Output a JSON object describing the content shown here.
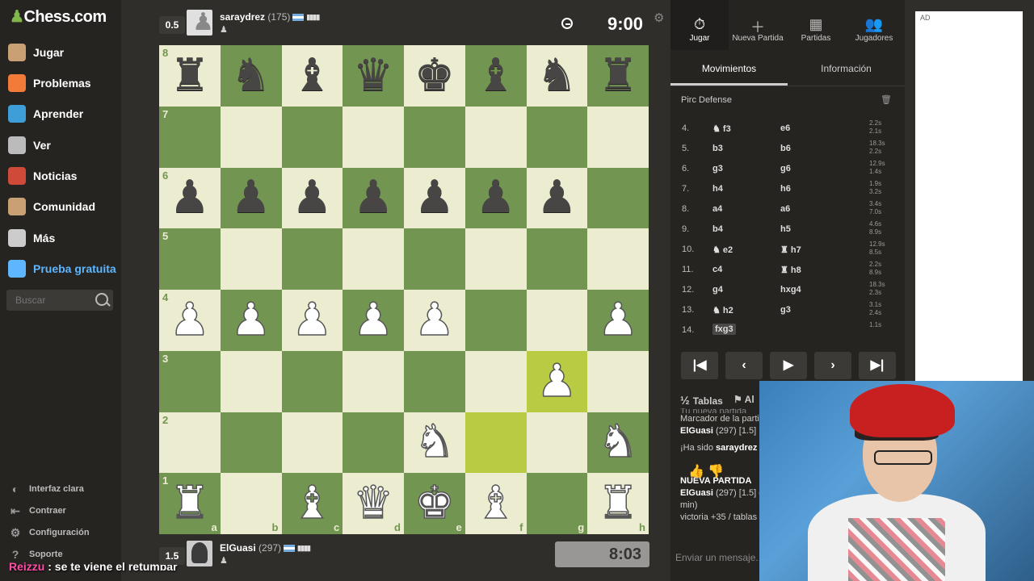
{
  "app": {
    "logo": "Chess.com"
  },
  "sidebar": {
    "items": [
      {
        "label": "Jugar",
        "icon": "play-pawn-icon",
        "color": "#c8a074"
      },
      {
        "label": "Problemas",
        "icon": "puzzle-icon",
        "color": "#f27b3a"
      },
      {
        "label": "Aprender",
        "icon": "learn-cap-icon",
        "color": "#3e9fd8"
      },
      {
        "label": "Ver",
        "icon": "binoculars-icon",
        "color": "#bbbbbb"
      },
      {
        "label": "Noticias",
        "icon": "news-icon",
        "color": "#d04a3a"
      },
      {
        "label": "Comunidad",
        "icon": "community-icon",
        "color": "#c8a074"
      },
      {
        "label": "Más",
        "icon": "more-dots-icon",
        "color": "#cccccc"
      },
      {
        "label": "Prueba gratuita",
        "icon": "diamond-icon",
        "color": "#5db6ff"
      }
    ],
    "search_placeholder": "Buscar",
    "bottom": [
      {
        "label": "Interfaz clara",
        "icon": "half-circle-icon"
      },
      {
        "label": "Contraer",
        "icon": "collapse-arrow-icon"
      },
      {
        "label": "Configuración",
        "icon": "settings-gear-icon"
      },
      {
        "label": "Soporte",
        "icon": "help-icon"
      }
    ]
  },
  "stream_chat": {
    "user": "Reizzu",
    "message": " : se te viene el retumbar"
  },
  "top_player": {
    "score": "0.5",
    "name": "saraydrez",
    "rating": "(175)",
    "clock": "9:00"
  },
  "bottom_player": {
    "score": "1.5",
    "name": "ElGuasi",
    "rating": "(297)",
    "clock": "8:03"
  },
  "board": {
    "rank_labels": [
      "8",
      "7",
      "6",
      "5",
      "4",
      "3",
      "2",
      "1"
    ],
    "file_labels": [
      "a",
      "b",
      "c",
      "d",
      "e",
      "f",
      "g",
      "h"
    ],
    "position": [
      [
        "bR",
        "bN",
        "bB",
        "bQ",
        "bK",
        "bB",
        "bN",
        "bR"
      ],
      [
        "",
        "",
        "",
        "",
        "",
        "",
        "",
        ""
      ],
      [
        "bP",
        "bP",
        "bP",
        "bP",
        "bP",
        "bP",
        "bP",
        ""
      ],
      [
        "",
        "",
        "",
        "",
        "",
        "",
        "",
        ""
      ],
      [
        "wP",
        "wP",
        "wP",
        "wP",
        "wP",
        "",
        "",
        "wP"
      ],
      [
        "",
        "",
        "",
        "",
        "",
        "",
        "wP",
        ""
      ],
      [
        "",
        "",
        "",
        "",
        "wN",
        "",
        "",
        "wN"
      ],
      [
        "wR",
        "",
        "wB",
        "wQ",
        "wK",
        "wB",
        "",
        "wR"
      ]
    ],
    "highlight_squares": [
      "f2",
      "g3"
    ],
    "colors": {
      "light": "#ebecd0",
      "dark": "#739552",
      "highlight": "#b9ca43"
    }
  },
  "right_panel": {
    "top_tabs": [
      {
        "label": "Jugar",
        "icon": "stopwatch-icon"
      },
      {
        "label": "Nueva Partida",
        "icon": "plus-icon"
      },
      {
        "label": "Partidas",
        "icon": "board-grid-icon"
      },
      {
        "label": "Jugadores",
        "icon": "players-icon"
      }
    ],
    "sub_tabs": [
      "Movimientos",
      "Información"
    ],
    "opening": "Pirc Defense",
    "moves": [
      {
        "num": "4.",
        "w": "f3",
        "w_icon": "knight",
        "b": "e6",
        "b_icon": "",
        "tw": "2.2s",
        "tb": "2.1s"
      },
      {
        "num": "5.",
        "w": "b3",
        "w_icon": "",
        "b": "b6",
        "b_icon": "",
        "tw": "18.3s",
        "tb": "2.2s"
      },
      {
        "num": "6.",
        "w": "g3",
        "w_icon": "",
        "b": "g6",
        "b_icon": "",
        "tw": "12.9s",
        "tb": "1.4s"
      },
      {
        "num": "7.",
        "w": "h4",
        "w_icon": "",
        "b": "h6",
        "b_icon": "",
        "tw": "1.9s",
        "tb": "3.2s"
      },
      {
        "num": "8.",
        "w": "a4",
        "w_icon": "",
        "b": "a6",
        "b_icon": "",
        "tw": "3.4s",
        "tb": "7.0s"
      },
      {
        "num": "9.",
        "w": "b4",
        "w_icon": "",
        "b": "h5",
        "b_icon": "",
        "tw": "4.6s",
        "tb": "8.9s"
      },
      {
        "num": "10.",
        "w": "e2",
        "w_icon": "knight",
        "b": "h7",
        "b_icon": "rook",
        "tw": "12.9s",
        "tb": "8.5s"
      },
      {
        "num": "11.",
        "w": "c4",
        "w_icon": "",
        "b": "h8",
        "b_icon": "rook",
        "tw": "2.2s",
        "tb": "8.9s"
      },
      {
        "num": "12.",
        "w": "g4",
        "w_icon": "",
        "b": "hxg4",
        "b_icon": "",
        "tw": "18.3s",
        "tb": "2.3s"
      },
      {
        "num": "13.",
        "w": "h2",
        "w_icon": "knight",
        "b": "g3",
        "b_icon": "",
        "tw": "3.1s",
        "tb": "2.4s"
      },
      {
        "num": "14.",
        "w": "fxg3",
        "w_icon": "",
        "b": "",
        "b_icon": "",
        "tw": "1.1s",
        "tb": ""
      }
    ],
    "draw_label": "Tablas",
    "abort_label": "Al",
    "log": {
      "line0": "Tu nueva partida",
      "line1": "Marcador de la parti",
      "line2_name": "ElGuasi",
      "line2_rest": " (297) [1.5]",
      "line3_pre": "¡Ha sido ",
      "line3_name": "saraydrez",
      "line4": "NUEVA PARTIDA",
      "line5_name": "ElGuasi",
      "line5_rest": " (297) [1.5] c",
      "line6": "min)",
      "line7": "victoria +35 / tablas"
    },
    "chat_placeholder": "Enviar un mensaje..."
  },
  "ad": {
    "label": "AD"
  }
}
